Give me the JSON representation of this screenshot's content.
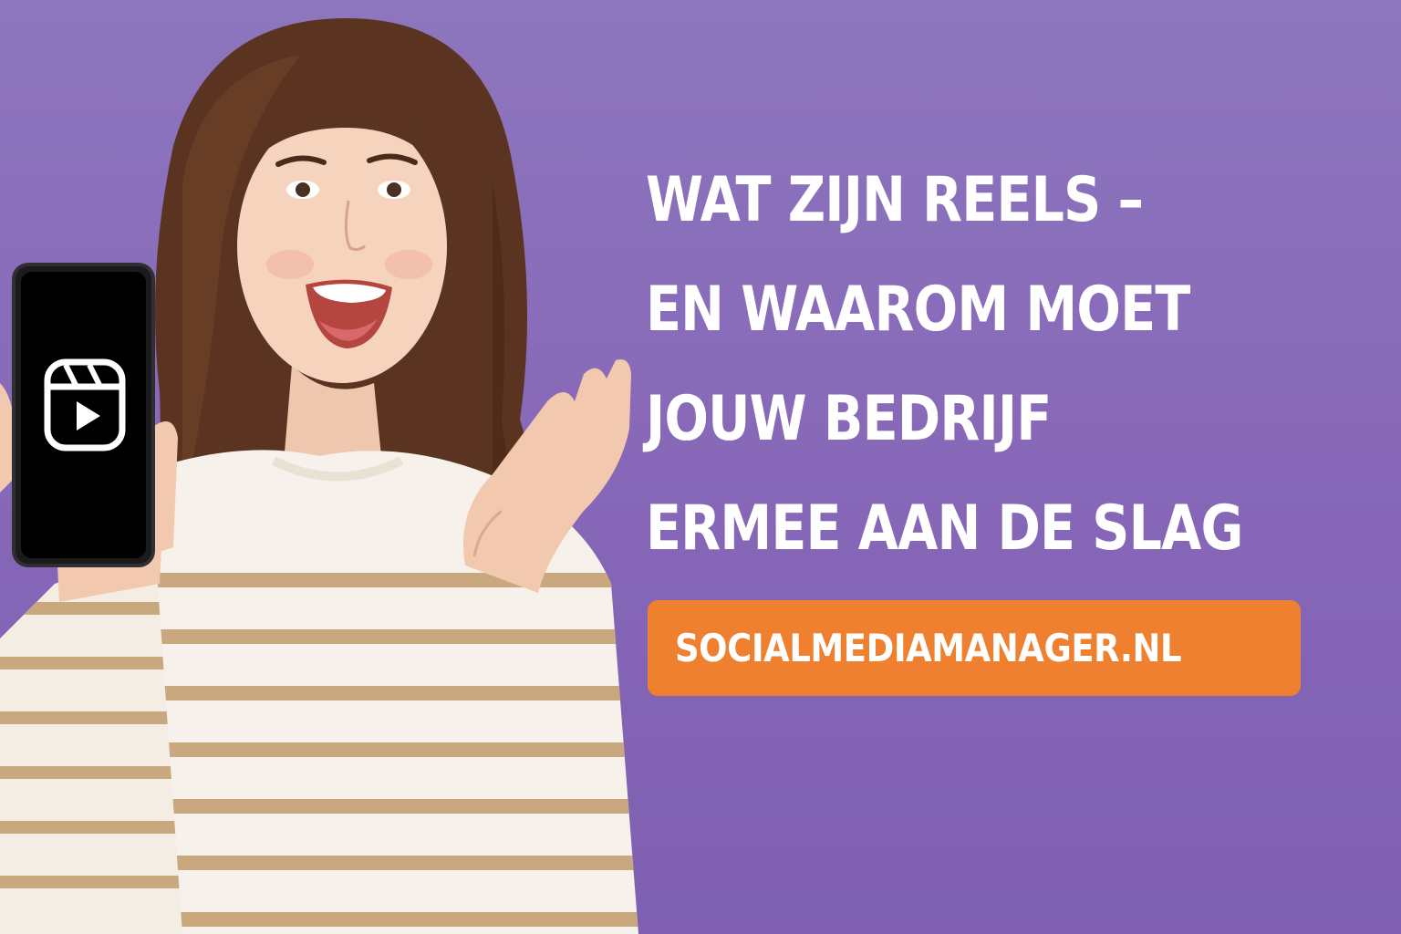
{
  "headline": {
    "lines": [
      "WAT ZIJN REELS –",
      "EN WAAROM MOET",
      "JOUW BEDRIJF",
      "ERMEE AAN DE SLAG"
    ]
  },
  "cta": {
    "label": "SOCIALMEDIAMANAGER.NL"
  },
  "colors": {
    "background": "#8768b8",
    "cta": "#ee8030",
    "text": "#ffffff",
    "sweater_stripe": "#c9a87f",
    "hair": "#5a3420"
  },
  "icons": {
    "phone_app": "reels-icon"
  }
}
